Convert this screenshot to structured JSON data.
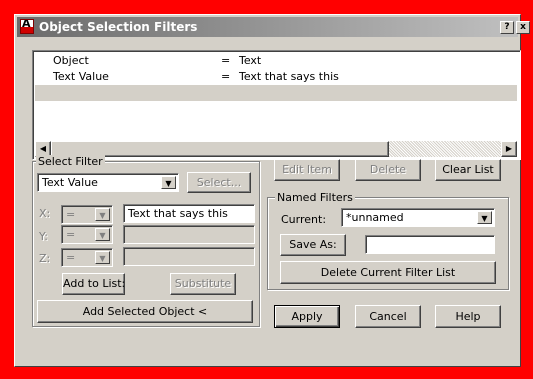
{
  "title": "Object Selection Filters",
  "title_buttons": {
    "help": "?",
    "close": "x"
  },
  "filter_list": {
    "rows": [
      {
        "name": "Object",
        "op": "=",
        "value": "Text"
      },
      {
        "name": "Text Value",
        "op": "=",
        "value": "Text that says this"
      }
    ]
  },
  "select_filter": {
    "legend": "Select Filter",
    "type_value": "Text Value",
    "select_btn": "Select...",
    "x_label": "X:",
    "y_label": "Y:",
    "z_label": "Z:",
    "x_op": "=",
    "y_op": "=",
    "z_op": "=",
    "x_value": "Text that says this",
    "y_value": "",
    "z_value": "",
    "add_to_list": "Add to List:",
    "substitute": "Substitute",
    "add_selected_object": "Add Selected Object <"
  },
  "list_actions": {
    "edit_item": "Edit Item",
    "delete": "Delete",
    "clear_list": "Clear List"
  },
  "named_filters": {
    "legend": "Named Filters",
    "current_label": "Current:",
    "current_value": "*unnamed",
    "save_as": "Save As:",
    "save_as_value": "",
    "delete_current": "Delete Current Filter List"
  },
  "footer": {
    "apply": "Apply",
    "cancel": "Cancel",
    "help": "Help"
  }
}
